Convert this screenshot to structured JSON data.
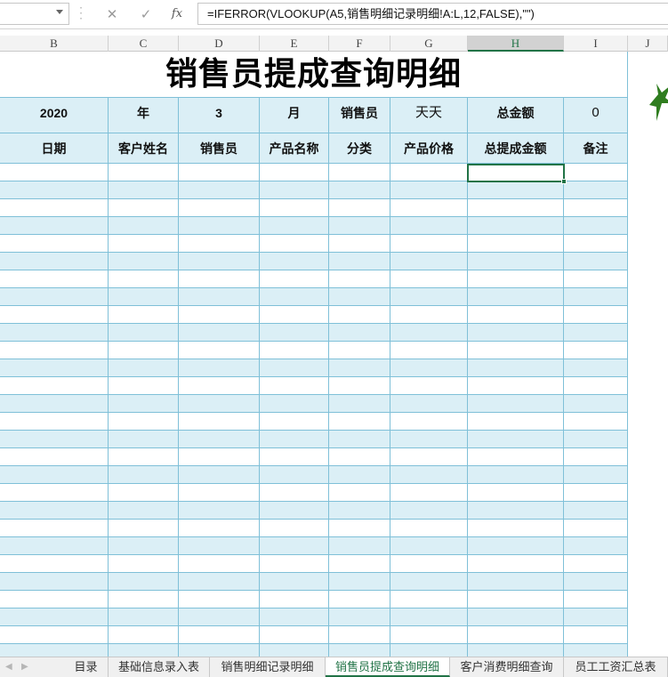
{
  "formula_bar": {
    "name_box": "",
    "cancel_icon": "x-icon",
    "confirm_icon": "check-icon",
    "fx_label": "fx",
    "formula": "=IFERROR(VLOOKUP(A5,销售明细记录明细!A:L,12,FALSE),\"\")"
  },
  "columns": [
    "B",
    "C",
    "D",
    "E",
    "F",
    "G",
    "H",
    "I",
    "J"
  ],
  "selected_column": "H",
  "sheet": {
    "title": "销售员提成查询明细",
    "info_row": {
      "year": "2020",
      "year_label": "年",
      "month": "3",
      "month_label": "月",
      "salesperson_label": "销售员",
      "salesperson_value": "天天",
      "total_label": "总金额",
      "total_value": "0"
    },
    "headers": [
      "日期",
      "客户姓名",
      "销售员",
      "产品名称",
      "分类",
      "产品价格",
      "总提成金额",
      "备注"
    ],
    "empty_rows": 28,
    "decoration": "leaf-icon"
  },
  "tabs": {
    "items": [
      "目录",
      "基础信息录入表",
      "销售明细记录明细",
      "销售员提成查询明细",
      "客户消费明细查询",
      "员工工资汇总表"
    ],
    "active": 3
  },
  "colors": {
    "accent": "#217346",
    "band": "#dbeff6",
    "grid": "#7fc0d8"
  }
}
